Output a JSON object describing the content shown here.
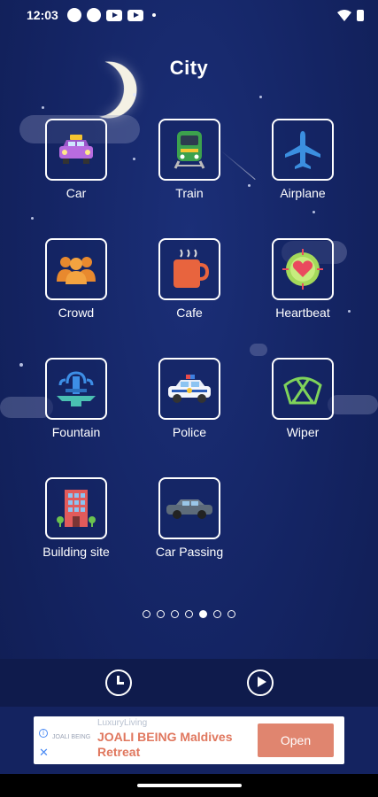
{
  "status_bar": {
    "time": "12:03",
    "icons": [
      "circle-notification-icon",
      "circle-notification-icon",
      "youtube-icon",
      "youtube-icon",
      "dot-icon",
      "wifi-icon",
      "battery-icon"
    ]
  },
  "page": {
    "title": "City"
  },
  "sounds": [
    {
      "label": "Car",
      "icon": "taxi-car-icon"
    },
    {
      "label": "Train",
      "icon": "train-icon"
    },
    {
      "label": "Airplane",
      "icon": "airplane-icon"
    },
    {
      "label": "Crowd",
      "icon": "crowd-icon"
    },
    {
      "label": "Cafe",
      "icon": "coffee-mug-icon"
    },
    {
      "label": "Heartbeat",
      "icon": "heartbeat-icon"
    },
    {
      "label": "Fountain",
      "icon": "fountain-icon"
    },
    {
      "label": "Police",
      "icon": "police-car-icon"
    },
    {
      "label": "Wiper",
      "icon": "windshield-wiper-icon"
    },
    {
      "label": "Building site",
      "icon": "building-icon"
    },
    {
      "label": "Car Passing",
      "icon": "car-passing-icon"
    }
  ],
  "pager": {
    "total": 7,
    "active_index": 4
  },
  "bottom_bar": {
    "timer_icon": "clock-icon",
    "play_icon": "play-icon"
  },
  "ad": {
    "source": "LuxuryLiving",
    "brand": "JOALI BEING",
    "title": "JOALI BEING Maldives Retreat",
    "cta": "Open",
    "info_icon": "info-icon",
    "close_icon": "close-icon"
  },
  "colors": {
    "background": "#142360",
    "ad_accent": "#e0775e",
    "ad_button": "#e0856f"
  }
}
